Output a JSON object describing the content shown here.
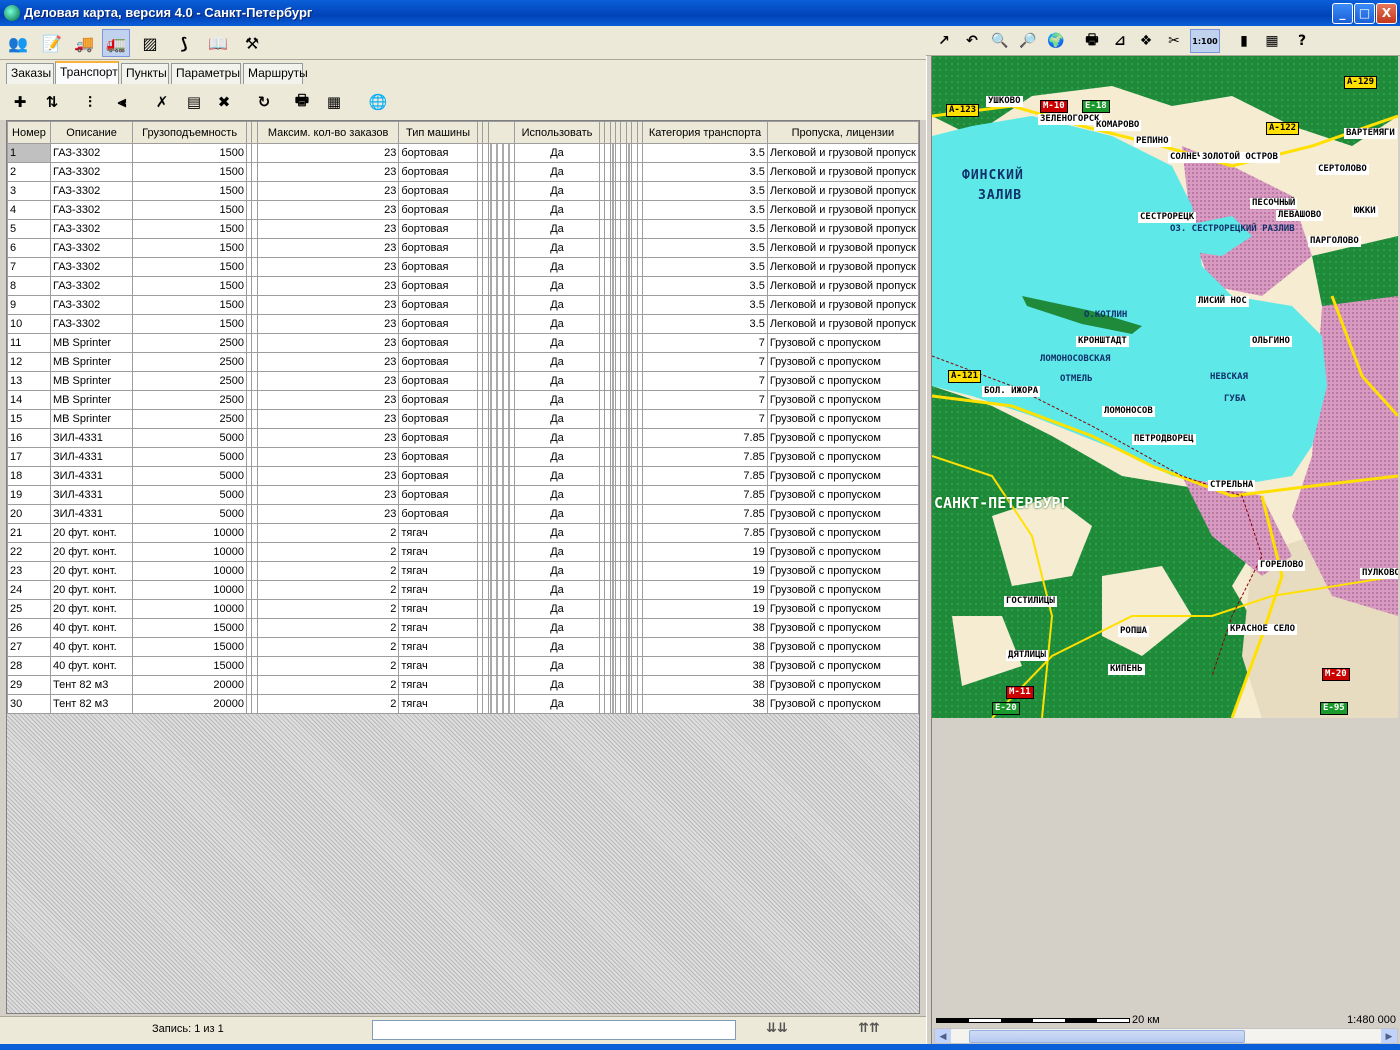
{
  "window": {
    "title": "Деловая карта, версия 4.0 - Санкт-Петербург",
    "app_icon": "globe-icon",
    "minimize": "_",
    "maximize": "□",
    "close": "X"
  },
  "main_toolbar": {
    "buttons": [
      {
        "icon": "people-icon",
        "glyph": "👥"
      },
      {
        "icon": "document-icon",
        "glyph": "📝"
      },
      {
        "icon": "loader-truck-icon",
        "glyph": "🚚"
      },
      {
        "icon": "truck-icon",
        "glyph": "🚛"
      },
      {
        "icon": "layers-icon",
        "glyph": "▨"
      },
      {
        "icon": "route-icon",
        "glyph": "⟆"
      },
      {
        "icon": "book-icon",
        "glyph": "📖"
      },
      {
        "icon": "tools-icon",
        "glyph": "⚒"
      }
    ]
  },
  "map_toolbar": {
    "buttons": [
      {
        "icon": "pointer-arrow-icon",
        "glyph": "↗"
      },
      {
        "icon": "undo-icon",
        "glyph": "↶"
      },
      {
        "icon": "zoom-in-icon",
        "glyph": "🔍"
      },
      {
        "icon": "zoom-out-icon",
        "glyph": "🔎"
      },
      {
        "icon": "globe-icon",
        "glyph": "🌍"
      },
      {
        "icon": "print-icon",
        "glyph": "🖶"
      },
      {
        "icon": "measure-icon",
        "glyph": "⊿"
      },
      {
        "icon": "layers-icon",
        "glyph": "❖"
      },
      {
        "icon": "scissors-icon",
        "glyph": "✂"
      },
      {
        "icon": "scale-icon",
        "glyph": "1:100"
      },
      {
        "icon": "bar-chart-icon",
        "glyph": "▮"
      },
      {
        "icon": "map-legend-icon",
        "glyph": "▦"
      },
      {
        "icon": "help-icon",
        "glyph": "?"
      }
    ]
  },
  "tabs": [
    {
      "label": "Заказы"
    },
    {
      "label": "Транспорт"
    },
    {
      "label": "Пункты"
    },
    {
      "label": "Параметры"
    },
    {
      "label": "Маршруты"
    }
  ],
  "sub_toolbar": {
    "buttons": [
      {
        "icon": "add-record-icon",
        "glyph": "✚"
      },
      {
        "icon": "sort-icon",
        "glyph": "⇅"
      },
      {
        "icon": "filter-icon",
        "glyph": "⫶"
      },
      {
        "icon": "filter-clear-icon",
        "glyph": "⫷"
      },
      {
        "icon": "delete-mark-icon",
        "glyph": "✗"
      },
      {
        "icon": "select-all-icon",
        "glyph": "▤"
      },
      {
        "icon": "delete-icon",
        "glyph": "✖"
      },
      {
        "icon": "refresh-icon",
        "glyph": "↻"
      },
      {
        "icon": "print-icon",
        "glyph": "🖶"
      },
      {
        "icon": "table-icon",
        "glyph": "▦"
      },
      {
        "icon": "globe-icon",
        "glyph": "🌐"
      }
    ]
  },
  "table": {
    "columns": {
      "num": "Номер",
      "desc": "Описание",
      "cap": "Грузоподъемность",
      "max": "Максим. кол-во заказов",
      "type": "Тип машины",
      "use": "Использовать",
      "cat": "Категория транспорта",
      "pass": "Пропуска, лицензии"
    },
    "rows": [
      [
        "1",
        "ГАЗ-3302",
        "1500",
        "23",
        "бортовая",
        "Да",
        "3.5",
        "Легковой и грузовой пропуск"
      ],
      [
        "2",
        "ГАЗ-3302",
        "1500",
        "23",
        "бортовая",
        "Да",
        "3.5",
        "Легковой и грузовой пропуск"
      ],
      [
        "3",
        "ГАЗ-3302",
        "1500",
        "23",
        "бортовая",
        "Да",
        "3.5",
        "Легковой и грузовой пропуск"
      ],
      [
        "4",
        "ГАЗ-3302",
        "1500",
        "23",
        "бортовая",
        "Да",
        "3.5",
        "Легковой и грузовой пропуск"
      ],
      [
        "5",
        "ГАЗ-3302",
        "1500",
        "23",
        "бортовая",
        "Да",
        "3.5",
        "Легковой и грузовой пропуск"
      ],
      [
        "6",
        "ГАЗ-3302",
        "1500",
        "23",
        "бортовая",
        "Да",
        "3.5",
        "Легковой и грузовой пропуск"
      ],
      [
        "7",
        "ГАЗ-3302",
        "1500",
        "23",
        "бортовая",
        "Да",
        "3.5",
        "Легковой и грузовой пропуск"
      ],
      [
        "8",
        "ГАЗ-3302",
        "1500",
        "23",
        "бортовая",
        "Да",
        "3.5",
        "Легковой и грузовой пропуск"
      ],
      [
        "9",
        "ГАЗ-3302",
        "1500",
        "23",
        "бортовая",
        "Да",
        "3.5",
        "Легковой и грузовой пропуск"
      ],
      [
        "10",
        "ГАЗ-3302",
        "1500",
        "23",
        "бортовая",
        "Да",
        "3.5",
        "Легковой и грузовой пропуск"
      ],
      [
        "11",
        "MB Sprinter",
        "2500",
        "23",
        "бортовая",
        "Да",
        "7",
        "Грузовой с пропуском"
      ],
      [
        "12",
        "MB Sprinter",
        "2500",
        "23",
        "бортовая",
        "Да",
        "7",
        "Грузовой с пропуском"
      ],
      [
        "13",
        "MB Sprinter",
        "2500",
        "23",
        "бортовая",
        "Да",
        "7",
        "Грузовой с пропуском"
      ],
      [
        "14",
        "MB Sprinter",
        "2500",
        "23",
        "бортовая",
        "Да",
        "7",
        "Грузовой с пропуском"
      ],
      [
        "15",
        "MB Sprinter",
        "2500",
        "23",
        "бортовая",
        "Да",
        "7",
        "Грузовой с пропуском"
      ],
      [
        "16",
        "ЗИЛ-4331",
        "5000",
        "23",
        "бортовая",
        "Да",
        "7.85",
        "Грузовой с пропуском"
      ],
      [
        "17",
        "ЗИЛ-4331",
        "5000",
        "23",
        "бортовая",
        "Да",
        "7.85",
        "Грузовой с пропуском"
      ],
      [
        "18",
        "ЗИЛ-4331",
        "5000",
        "23",
        "бортовая",
        "Да",
        "7.85",
        "Грузовой с пропуском"
      ],
      [
        "19",
        "ЗИЛ-4331",
        "5000",
        "23",
        "бортовая",
        "Да",
        "7.85",
        "Грузовой с пропуском"
      ],
      [
        "20",
        "ЗИЛ-4331",
        "5000",
        "23",
        "бортовая",
        "Да",
        "7.85",
        "Грузовой с пропуском"
      ],
      [
        "21",
        "20 фут. конт.",
        "10000",
        "2",
        "тягач",
        "Да",
        "7.85",
        "Грузовой с пропуском"
      ],
      [
        "22",
        "20 фут. конт.",
        "10000",
        "2",
        "тягач",
        "Да",
        "19",
        "Грузовой с пропуском"
      ],
      [
        "23",
        "20 фут. конт.",
        "10000",
        "2",
        "тягач",
        "Да",
        "19",
        "Грузовой с пропуском"
      ],
      [
        "24",
        "20 фут. конт.",
        "10000",
        "2",
        "тягач",
        "Да",
        "19",
        "Грузовой с пропуском"
      ],
      [
        "25",
        "20 фут. конт.",
        "10000",
        "2",
        "тягач",
        "Да",
        "19",
        "Грузовой с пропуском"
      ],
      [
        "26",
        "40 фут. конт.",
        "15000",
        "2",
        "тягач",
        "Да",
        "38",
        "Грузовой с пропуском"
      ],
      [
        "27",
        "40 фут. конт.",
        "15000",
        "2",
        "тягач",
        "Да",
        "38",
        "Грузовой с пропуском"
      ],
      [
        "28",
        "40 фут. конт.",
        "15000",
        "2",
        "тягач",
        "Да",
        "38",
        "Грузовой с пропуском"
      ],
      [
        "29",
        "Тент 82 м3",
        "20000",
        "2",
        "тягач",
        "Да",
        "38",
        "Грузовой с пропуском"
      ],
      [
        "30",
        "Тент 82 м3",
        "20000",
        "2",
        "тягач",
        "Да",
        "38",
        "Грузовой с пропуском"
      ]
    ]
  },
  "status": {
    "record": "Запись: 1 из 1",
    "search_value": "",
    "nav_prev": "⇊⇊",
    "nav_next": "⇈⇈"
  },
  "map": {
    "labels": [
      {
        "t": "УШКОВО",
        "k": ""
      },
      {
        "t": "М-10",
        "k": "mroad"
      },
      {
        "t": "Е-18",
        "k": "eroad"
      },
      {
        "t": "ЗЕЛЕНОГОРСК",
        "k": ""
      },
      {
        "t": "КОМАРОВО",
        "k": ""
      },
      {
        "t": "А-122",
        "k": "road"
      },
      {
        "t": "А-129",
        "k": "road"
      },
      {
        "t": "А-123",
        "k": "road"
      },
      {
        "t": "ВАРТЕМЯГИ",
        "k": ""
      },
      {
        "t": "РЕПИНО",
        "k": ""
      },
      {
        "t": "СОЛНЕЧНОЕ",
        "k": ""
      },
      {
        "t": "ЗОЛОТОЙ ОСТРОВ",
        "k": ""
      },
      {
        "t": "СЕРТОЛОВО",
        "k": ""
      },
      {
        "t": "ФИНСКИЙ",
        "k": "big"
      },
      {
        "t": "ЗАЛИВ",
        "k": "big"
      },
      {
        "t": "ПЕСОЧНЫЙ",
        "k": ""
      },
      {
        "t": "ЛЕВАШОВО",
        "k": ""
      },
      {
        "t": "ЮККИ",
        "k": ""
      },
      {
        "t": "СЕСТРОРЕЦК",
        "k": ""
      },
      {
        "t": "ОЗ. СЕСТРОРЕЦКИЙ РАЗЛИВ",
        "k": "sea"
      },
      {
        "t": "ПАРГОЛОВО",
        "k": ""
      },
      {
        "t": "ЛИСИЙ НОС",
        "k": ""
      },
      {
        "t": "О.КОТЛИН",
        "k": "sea"
      },
      {
        "t": "КРОНШТАДТ",
        "k": ""
      },
      {
        "t": "ОЛЬГИНО",
        "k": ""
      },
      {
        "t": "ЛОМОНОСОВСКАЯ",
        "k": "sea"
      },
      {
        "t": "ОТМЕЛЬ",
        "k": "sea"
      },
      {
        "t": "НЕВСКАЯ",
        "k": "sea"
      },
      {
        "t": "ГУБА",
        "k": "sea"
      },
      {
        "t": "А-121",
        "k": "road"
      },
      {
        "t": "БОЛ. ИЖОРА",
        "k": ""
      },
      {
        "t": "ЛОМОНОСОВ",
        "k": ""
      },
      {
        "t": "ПЕТРОДВОРЕЦ",
        "k": ""
      },
      {
        "t": "СТРЕЛЬНА",
        "k": ""
      },
      {
        "t": "САНКТ-ПЕТЕРБУРГ",
        "k": "city"
      },
      {
        "t": "ГОРЕЛОВО",
        "k": ""
      },
      {
        "t": "ПУЛКОВО",
        "k": ""
      },
      {
        "t": "ГОСТИЛИЦЫ",
        "k": ""
      },
      {
        "t": "РОПША",
        "k": ""
      },
      {
        "t": "КРАСНОЕ СЕЛО",
        "k": ""
      },
      {
        "t": "ДЯТЛИЦЫ",
        "k": ""
      },
      {
        "t": "КИПЕНЬ",
        "k": ""
      },
      {
        "t": "М-11",
        "k": "mroad"
      },
      {
        "t": "М-20",
        "k": "mroad"
      },
      {
        "t": "Е-20",
        "k": "eroad"
      },
      {
        "t": "Е-95",
        "k": "eroad"
      }
    ]
  },
  "scale": {
    "label": "20 км",
    "ratio": "1:480 000"
  },
  "colors": {
    "sea": "#5ee8e8",
    "forest": "#1e8a3a",
    "land": "#f5ecd2",
    "urban": "#e0a0c8",
    "road": "#ffe000",
    "title_bar": "#0a5fd8"
  }
}
